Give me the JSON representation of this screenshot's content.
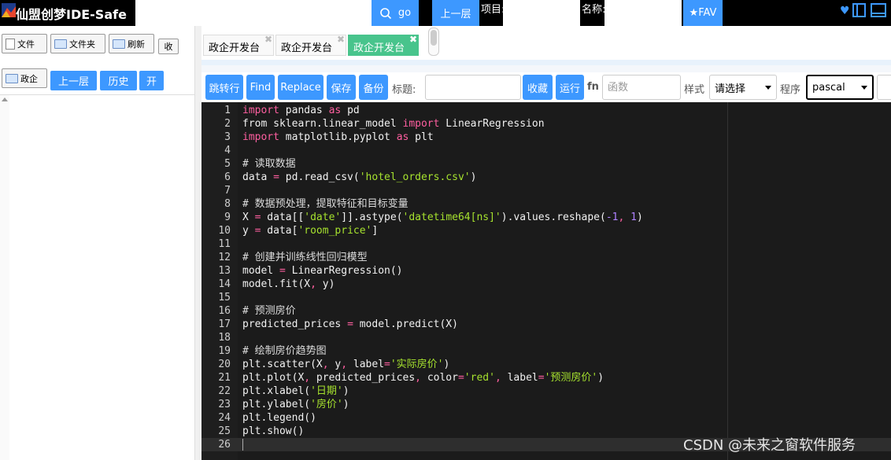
{
  "app": {
    "title": "仙盟创梦IDE-Safe"
  },
  "topbar": {
    "go_label": "go",
    "up_label": "上一层",
    "project_label": "项目:",
    "name_label": "名称:",
    "fav_label": "★FAV",
    "heart_glyph": "♥"
  },
  "sidebar": {
    "file_label": "文件",
    "folder_label": "文件夹",
    "refresh_label": "刷新",
    "collapse_label": "收",
    "gov_label": "政企",
    "up_label": "上一层",
    "history_label": "历史",
    "open_label": "开"
  },
  "tabs": [
    {
      "label": "政企开发台",
      "close": "✖"
    },
    {
      "label": "政企开发台",
      "close": "✖"
    },
    {
      "label": "政企开发台",
      "close": "✖"
    }
  ],
  "toolbar": {
    "jump_label": "跳转行",
    "find_label": "Find",
    "replace_label": "Replace",
    "save_label": "保存",
    "backup_label": "备份",
    "title_label": "标题:",
    "collect_label": "收藏",
    "run_label": "运行",
    "fn_label": "fn",
    "fn_placeholder": "函数",
    "style_label": "样式",
    "style_value": "请选择",
    "program_label": "程序",
    "program_value": "pascal"
  },
  "editor": {
    "active_line": 26,
    "lines": [
      [
        [
          "kw",
          "import"
        ],
        [
          "t",
          " pandas "
        ],
        [
          "kw",
          "as"
        ],
        [
          "t",
          " pd"
        ]
      ],
      [
        [
          "t",
          "from sklearn.linear_model "
        ],
        [
          "kw",
          "import"
        ],
        [
          "t",
          " LinearRegression"
        ]
      ],
      [
        [
          "kw",
          "import"
        ],
        [
          "t",
          " matplotlib.pyplot "
        ],
        [
          "kw",
          "as"
        ],
        [
          "t",
          " plt"
        ]
      ],
      [],
      [
        [
          "cm",
          "# 读取数据"
        ]
      ],
      [
        [
          "t",
          "data "
        ],
        [
          "op",
          "="
        ],
        [
          "t",
          " pd.read_csv("
        ],
        [
          "str",
          "'hotel_orders.csv'"
        ],
        [
          "t",
          ")"
        ]
      ],
      [],
      [
        [
          "cm",
          "# 数据预处理，提取特征和目标变量"
        ]
      ],
      [
        [
          "t",
          "X "
        ],
        [
          "op",
          "="
        ],
        [
          "t",
          " data[["
        ],
        [
          "str",
          "'date'"
        ],
        [
          "t",
          "]].astype("
        ],
        [
          "str",
          "'datetime64[ns]'"
        ],
        [
          "t",
          ").values.reshape("
        ],
        [
          "num",
          "-1"
        ],
        [
          "op",
          ","
        ],
        [
          "t",
          " "
        ],
        [
          "num",
          "1"
        ],
        [
          "t",
          ")"
        ]
      ],
      [
        [
          "t",
          "y "
        ],
        [
          "op",
          "="
        ],
        [
          "t",
          " data["
        ],
        [
          "str",
          "'room_price'"
        ],
        [
          "t",
          "]"
        ]
      ],
      [],
      [
        [
          "cm",
          "# 创建并训练线性回归模型"
        ]
      ],
      [
        [
          "t",
          "model "
        ],
        [
          "op",
          "="
        ],
        [
          "t",
          " LinearRegression()"
        ]
      ],
      [
        [
          "t",
          "model.fit(X"
        ],
        [
          "op",
          ","
        ],
        [
          "t",
          " y)"
        ]
      ],
      [],
      [
        [
          "cm",
          "# 预测房价"
        ]
      ],
      [
        [
          "t",
          "predicted_prices "
        ],
        [
          "op",
          "="
        ],
        [
          "t",
          " model.predict(X)"
        ]
      ],
      [],
      [
        [
          "cm",
          "# 绘制房价趋势图"
        ]
      ],
      [
        [
          "t",
          "plt.scatter(X"
        ],
        [
          "op",
          ","
        ],
        [
          "t",
          " y"
        ],
        [
          "op",
          ","
        ],
        [
          "t",
          " label"
        ],
        [
          "op",
          "="
        ],
        [
          "str",
          "'实际房价'"
        ],
        [
          "t",
          ")"
        ]
      ],
      [
        [
          "t",
          "plt.plot(X"
        ],
        [
          "op",
          ","
        ],
        [
          "t",
          " predicted_prices"
        ],
        [
          "op",
          ","
        ],
        [
          "t",
          " color"
        ],
        [
          "op",
          "="
        ],
        [
          "str",
          "'red'"
        ],
        [
          "op",
          ","
        ],
        [
          "t",
          " label"
        ],
        [
          "op",
          "="
        ],
        [
          "str",
          "'预测房价'"
        ],
        [
          "t",
          ")"
        ]
      ],
      [
        [
          "t",
          "plt.xlabel("
        ],
        [
          "str",
          "'日期'"
        ],
        [
          "t",
          ")"
        ]
      ],
      [
        [
          "t",
          "plt.ylabel("
        ],
        [
          "str",
          "'房价'"
        ],
        [
          "t",
          ")"
        ]
      ],
      [
        [
          "t",
          "plt.legend()"
        ]
      ],
      [
        [
          "t",
          "plt.show()"
        ]
      ],
      []
    ]
  },
  "watermark": "CSDN @未来之窗软件服务",
  "colors": {
    "accent_blue": "#3d98ff",
    "active_tab_green": "#48c48c",
    "editor_bg": "#1b1b1b",
    "keyword_pink": "#ff5fa0",
    "string_green": "#a6e22e",
    "number_purple": "#ae81ff"
  }
}
